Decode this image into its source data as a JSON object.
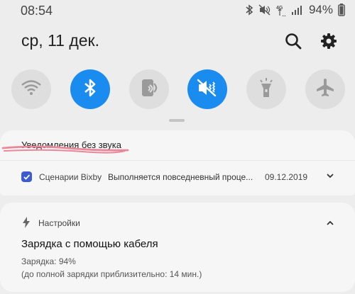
{
  "status_bar": {
    "time": "08:54",
    "network_label": "4G",
    "battery": "94%",
    "icons": [
      "bluetooth-icon",
      "mute-icon",
      "network-4g-icon",
      "signal-icon"
    ]
  },
  "header": {
    "date": "ср, 11 дек.",
    "icons": [
      "search-icon",
      "gear-icon"
    ]
  },
  "quick_settings": [
    {
      "name": "wifi",
      "icon": "wifi-icon",
      "active": false
    },
    {
      "name": "bluetooth",
      "icon": "bluetooth-icon",
      "active": true
    },
    {
      "name": "nfc",
      "icon": "nfc-icon",
      "active": false
    },
    {
      "name": "sound-mute",
      "icon": "sound-mute-icon",
      "active": true
    },
    {
      "name": "flashlight",
      "icon": "flashlight-icon",
      "active": false
    },
    {
      "name": "airplane",
      "icon": "airplane-icon",
      "active": false
    }
  ],
  "silent_section": {
    "title": "Уведомления без звука",
    "notification": {
      "app": "Сценарии Bixby",
      "text": "Выполняется повседневный проце...",
      "date": "09.12.2019"
    }
  },
  "charging_card": {
    "app": "Настройки",
    "title": "Зарядка с помощью кабеля",
    "line1": "Зарядка: 94%",
    "line2": "(до полной зарядки приблизительно: 14 мин.)"
  },
  "colors": {
    "accent": "#1a8cf0",
    "tile_off": "#dedede",
    "annotation_stroke": "#e8889a",
    "bixby_icon": "#3d5bd1"
  }
}
